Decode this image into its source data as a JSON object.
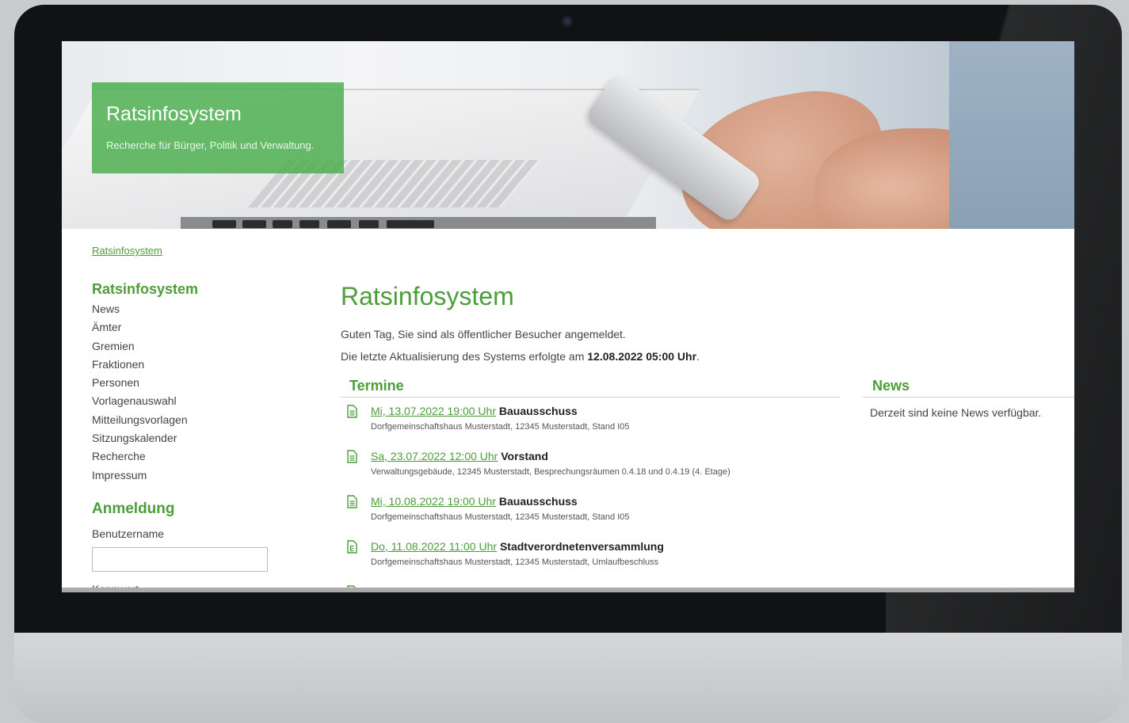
{
  "site": {
    "title": "Ratsinfosystem",
    "subtitle": "Recherche für Bürger, Politik und Verwaltung."
  },
  "breadcrumb": {
    "label": "Ratsinfosystem"
  },
  "sidebar": {
    "heading": "Ratsinfosystem",
    "items": [
      {
        "label": "News"
      },
      {
        "label": "Ämter"
      },
      {
        "label": "Gremien"
      },
      {
        "label": "Fraktionen"
      },
      {
        "label": "Personen"
      },
      {
        "label": "Vorlagenauswahl"
      },
      {
        "label": "Mitteilungsvorlagen"
      },
      {
        "label": "Sitzungskalender"
      },
      {
        "label": "Recherche"
      },
      {
        "label": "Impressum"
      }
    ],
    "login": {
      "heading": "Anmeldung",
      "user_label": "Benutzername",
      "user_value": "",
      "password_label": "Kennwort"
    }
  },
  "main": {
    "title": "Ratsinfosystem",
    "greeting": "Guten Tag, Sie sind als öffentlicher Besucher angemeldet.",
    "update_prefix": "Die letzte Aktualisierung des Systems erfolgte am",
    "update_value": "12.08.2022 05:00 Uhr",
    "update_suffix": ".",
    "termine": {
      "heading": "Termine",
      "events": [
        {
          "date": "Mi, 13.07.2022 19:00 Uhr",
          "title": "Bauausschuss",
          "location": "Dorfgemeinschaftshaus Musterstadt, 12345 Musterstadt, Stand I05"
        },
        {
          "date": "Sa, 23.07.2022 12:00 Uhr",
          "title": "Vorstand",
          "location": "Verwaltungsgebäude, 12345 Musterstadt, Besprechungsräumen 0.4.18 und 0.4.19 (4. Etage)"
        },
        {
          "date": "Mi, 10.08.2022 19:00 Uhr",
          "title": "Bauausschuss",
          "location": "Dorfgemeinschaftshaus Musterstadt, 12345 Musterstadt, Stand I05"
        },
        {
          "date": "Do, 11.08.2022 11:00 Uhr",
          "title": "Stadtverordnetenversammlung",
          "location": "Dorfgemeinschaftshaus Musterstadt, 12345 Musterstadt, Umlaufbeschluss"
        }
      ]
    },
    "news": {
      "heading": "News",
      "empty": "Derzeit sind keine News verfügbar."
    }
  },
  "colors": {
    "accent": "#4c9d3a",
    "title_box": "#5cb35e",
    "bezel": "#111213",
    "frame": "#c9cacc"
  }
}
